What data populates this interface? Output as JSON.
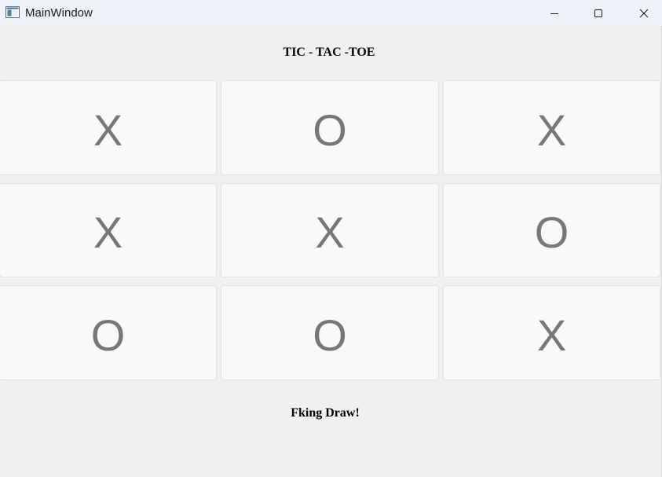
{
  "window": {
    "title": "MainWindow",
    "icon": "app-window-icon"
  },
  "controls": {
    "minimize_icon": "minimize-icon",
    "maximize_icon": "maximize-icon",
    "close_icon": "close-icon"
  },
  "header": {
    "title": "TIC - TAC -TOE"
  },
  "board": {
    "cells": [
      {
        "label": "X"
      },
      {
        "label": "O"
      },
      {
        "label": "X"
      },
      {
        "label": "X"
      },
      {
        "label": "X"
      },
      {
        "label": "O"
      },
      {
        "label": "O"
      },
      {
        "label": "O"
      },
      {
        "label": "X"
      }
    ]
  },
  "status": {
    "message": "Fking Draw!"
  },
  "colors": {
    "background": "#f0f0f0",
    "titlebar": "#eef3fa",
    "cell_background": "#f9f9f9",
    "cell_border": "#e2e2e2",
    "mark": "#777777"
  }
}
